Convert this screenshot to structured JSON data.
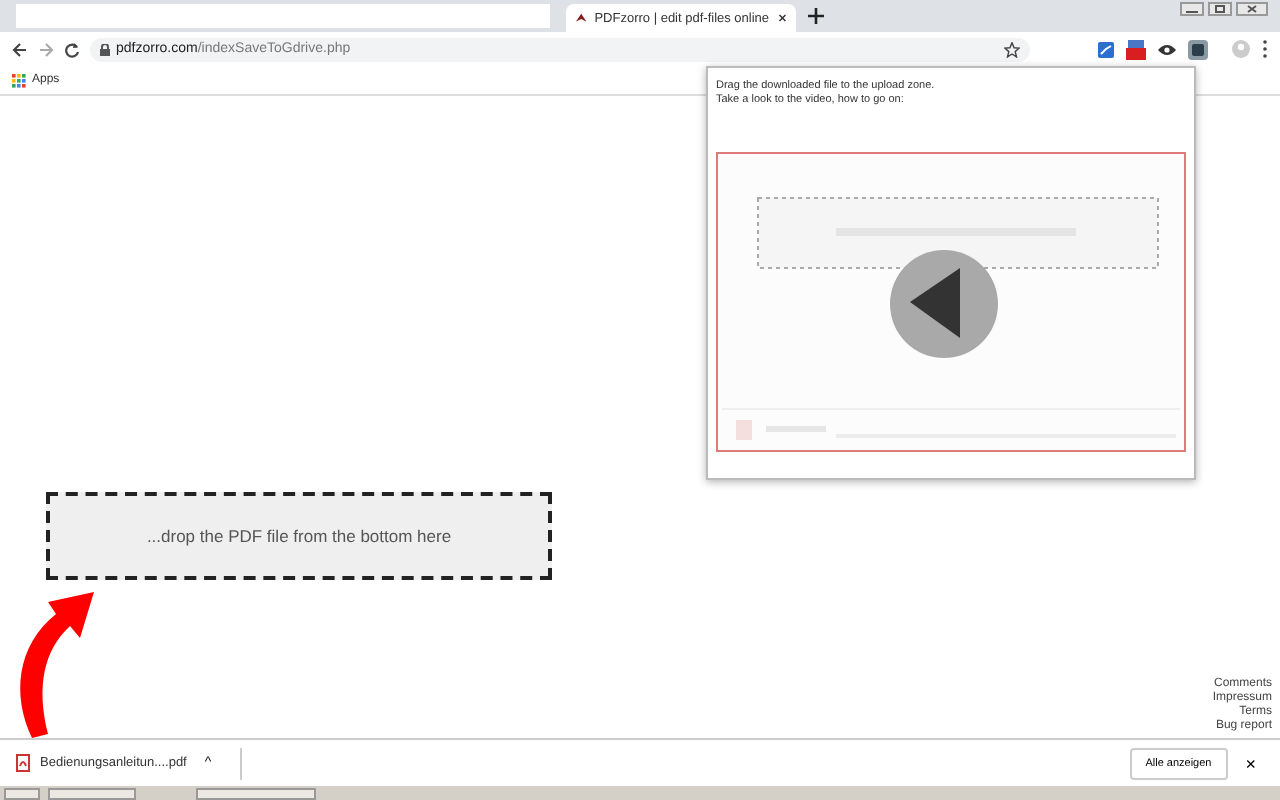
{
  "tabs": [
    {
      "title": "PDFzorro | edit pdf-files online",
      "selected": true
    }
  ],
  "toolbar": {
    "url_host": "pdfzorro.com",
    "url_path": "/indexSaveToGdrive.php"
  },
  "bookmarks": [
    {
      "label": "Apps"
    }
  ],
  "popup": {
    "lines": [
      "Drag the downloaded file to the upload zone.",
      "Take a look to the video, how to go on:"
    ]
  },
  "drop_zone": {
    "text": "...drop the PDF file from the bottom here"
  },
  "footer_links": [
    "Comments",
    "Impressum",
    "Terms",
    "Bug report"
  ],
  "download_bar": {
    "file": "Bedienungsanleitun....pdf",
    "caret": "^",
    "show_all": "Alle anzeigen",
    "close": "×"
  }
}
